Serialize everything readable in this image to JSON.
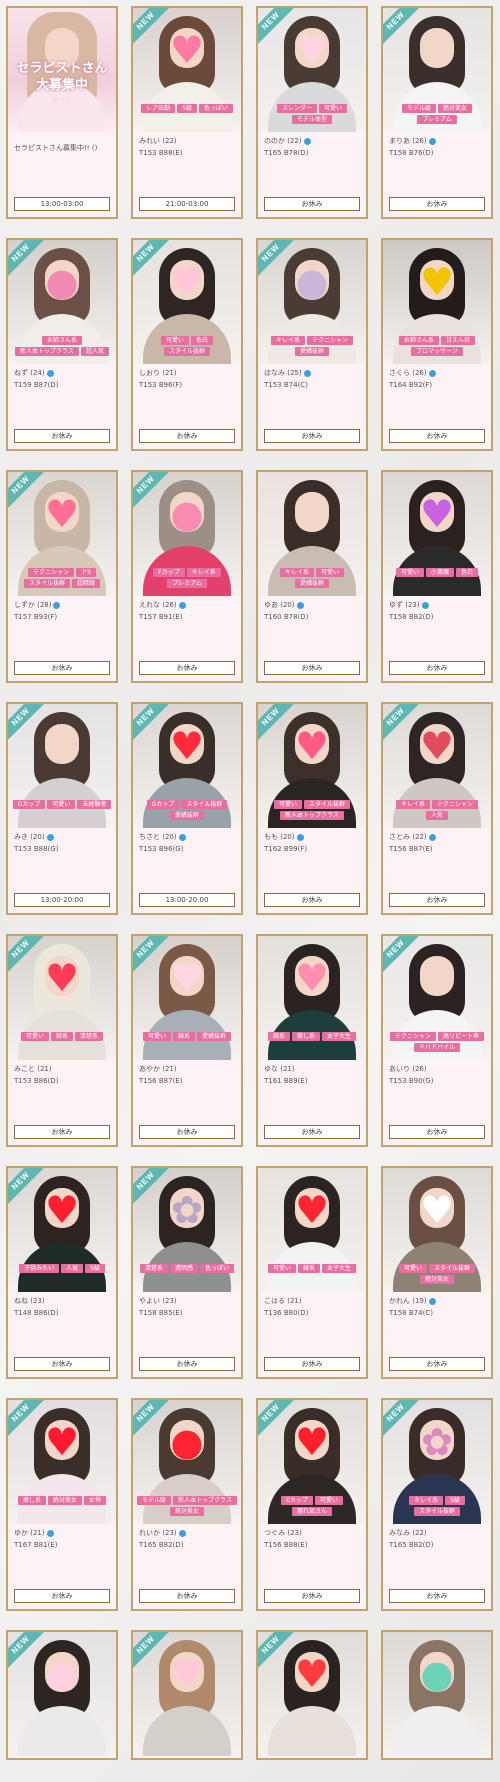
{
  "recruit_card": {
    "title_line1": "セラピストさん",
    "title_line2": "大募集中",
    "subtitle": "セラピ",
    "text": "セラピストさん募集中!! ()",
    "schedule": "13:00-03:00"
  },
  "new_badge_label": "NEW",
  "cards": [
    {
      "name": "みれい (22)",
      "stats": "T153 B88(E)",
      "tags": [
        "レア出勤",
        "S級",
        "色っぽい"
      ],
      "schedule": "21:00-03:00",
      "new": true,
      "verified": false,
      "hair": "#6b4a3a",
      "bg": "#d9d1cf",
      "body": "#f3efe9",
      "stamp": "♥",
      "stamp_color": "#ff7aa2"
    },
    {
      "name": "ののか (22)",
      "stats": "T165 B78(D)",
      "tags": [
        "スレンダー",
        "可愛い",
        "モデル体型"
      ],
      "schedule": "お休み",
      "new": true,
      "verified": true,
      "hair": "#4a3a34",
      "bg": "#e7e5e6",
      "body": "#d9dadb",
      "stamp": "♥",
      "stamp_color": "#ffd3e0"
    },
    {
      "name": "まりあ (26)",
      "stats": "T158 B76(D)",
      "tags": [
        "モデル級",
        "絶対美女",
        "プレミアム"
      ],
      "schedule": "お休み",
      "new": true,
      "verified": true,
      "hair": "#3a2f2c",
      "bg": "#e5e4e2",
      "body": "#f4f4f4",
      "stamp": "",
      "stamp_color": "#fff"
    },
    {
      "name": "ねず (24)",
      "stats": "T159 B87(D)",
      "tags": [
        "お姉さん系",
        "新人本トップクラス",
        "超人気"
      ],
      "schedule": "お休み",
      "new": true,
      "verified": true,
      "hair": "#6a5045",
      "bg": "#d4cfca",
      "body": "#f1ede8",
      "stamp": "●",
      "stamp_color": "#f08ab0"
    },
    {
      "name": "しおり (21)",
      "stats": "T153 B96(F)",
      "tags": [
        "可愛い",
        "色白",
        "スタイル抜群"
      ],
      "schedule": "お休み",
      "new": true,
      "verified": false,
      "hair": "#2e2623",
      "bg": "#e6e1dc",
      "body": "#c9b8a8",
      "stamp": "♥",
      "stamp_color": "#ffc6d8"
    },
    {
      "name": "ほなみ (25)",
      "stats": "T153 B74(C)",
      "tags": [
        "キレイ系",
        "テクニシャン",
        "愛嬌抜群"
      ],
      "schedule": "お休み",
      "new": true,
      "verified": true,
      "hair": "#4b3b35",
      "bg": "#d8d4cf",
      "body": "#efe9e4",
      "stamp": "●",
      "stamp_color": "#c9b6d9"
    },
    {
      "name": "さくら (26)",
      "stats": "T164 B92(F)",
      "tags": [
        "お姉さん系",
        "甘えん坊",
        "プロマッサージ"
      ],
      "schedule": "お休み",
      "new": false,
      "verified": true,
      "hair": "#231c1a",
      "bg": "#cfc8c4",
      "body": "#e8e1dc",
      "stamp": "♥",
      "stamp_color": "#f5c400"
    },
    {
      "name": "しずか (28)",
      "stats": "T157 B93(F)",
      "tags": [
        "テクニシャン",
        "ドS",
        "スタイル抜群",
        "超精鋭"
      ],
      "schedule": "お休み",
      "new": true,
      "verified": true,
      "hair": "#c8b6a6",
      "bg": "#dcd6d2",
      "body": "#d7c8ba",
      "stamp": "♥",
      "stamp_color": "#ff6f95"
    },
    {
      "name": "えれな (26)",
      "stats": "T157 B91(E)",
      "tags": [
        "Fカップ",
        "キレイ系",
        "プレミアム"
      ],
      "schedule": "お休み",
      "new": true,
      "verified": true,
      "hair": "#9e8f86",
      "bg": "#d8d2cc",
      "body": "#e3406b",
      "stamp": "●",
      "stamp_color": "#f78bb1"
    },
    {
      "name": "ゆあ (20)",
      "stats": "T160 B78(D)",
      "tags": [
        "キレイ系",
        "可愛い",
        "愛嬌抜群"
      ],
      "schedule": "お休み",
      "new": false,
      "verified": true,
      "hair": "#3b2e29",
      "bg": "#eae2e0",
      "body": "#c9bcb2",
      "stamp": "",
      "stamp_color": "#fff"
    },
    {
      "name": "ゆず (23)",
      "stats": "T158 B82(D)",
      "tags": [
        "可愛い",
        "小悪魔",
        "色白"
      ],
      "schedule": "お休み",
      "new": false,
      "verified": true,
      "hair": "#2b2220",
      "bg": "#ddd8d6",
      "body": "#2a2a2a",
      "stamp": "♥",
      "stamp_color": "#c862e0"
    },
    {
      "name": "みき (20)",
      "stats": "T153 B88(G)",
      "tags": [
        "Gカップ",
        "可愛い",
        "未経験者"
      ],
      "schedule": "13:00-20:00",
      "new": true,
      "verified": true,
      "hair": "#4a3a33",
      "bg": "#e4e3e4",
      "body": "#d5cfd3",
      "stamp": "",
      "stamp_color": "#fff"
    },
    {
      "name": "ちさと (20)",
      "stats": "T153 B96(G)",
      "tags": [
        "Gカップ",
        "スタイル抜群",
        "愛嬌抜群"
      ],
      "schedule": "13:00-20:00",
      "new": true,
      "verified": true,
      "hair": "#3a2e28",
      "bg": "#dbd6d3",
      "body": "#9aa1a8",
      "stamp": "♥",
      "stamp_color": "#ff2b3a"
    },
    {
      "name": "もも (20)",
      "stats": "T162 B99(F)",
      "tags": [
        "可愛い",
        "スタイル抜群",
        "新人本トップクラス"
      ],
      "schedule": "お休み",
      "new": true,
      "verified": true,
      "hair": "#3d302a",
      "bg": "#d9d3ce",
      "body": "#2a2522",
      "stamp": "♥",
      "stamp_color": "#ff5a86"
    },
    {
      "name": "さとみ (22)",
      "stats": "T156 B87(E)",
      "tags": [
        "キレイ系",
        "テクニシャン",
        "人気"
      ],
      "schedule": "お休み",
      "new": true,
      "verified": true,
      "hair": "#2d2624",
      "bg": "#dedad7",
      "body": "#cfc8c2",
      "stamp": "♥",
      "stamp_color": "#e24a60"
    },
    {
      "name": "みこと (21)",
      "stats": "T153 B86(D)",
      "tags": [
        "可愛い",
        "綺系",
        "清楚系"
      ],
      "schedule": "お休み",
      "new": true,
      "verified": false,
      "hair": "#ece6dc",
      "bg": "#d8d2cc",
      "body": "#e6e0da",
      "stamp": "♥",
      "stamp_color": "#ff3b5a"
    },
    {
      "name": "あやか (21)",
      "stats": "T156 B87(E)",
      "tags": [
        "可愛い",
        "綺系",
        "愛嬌抜群"
      ],
      "schedule": "お休み",
      "new": true,
      "verified": false,
      "hair": "#7a5a46",
      "bg": "#d6d0cb",
      "body": "#a7b0b6",
      "stamp": "♥",
      "stamp_color": "#ffd6e2"
    },
    {
      "name": "ゆな (21)",
      "stats": "T161 B89(E)",
      "tags": [
        "綺系",
        "癒し系",
        "女子大生"
      ],
      "schedule": "お休み",
      "new": false,
      "verified": false,
      "hair": "#2a2321",
      "bg": "#e3e0dc",
      "body": "#1d3e3a",
      "stamp": "♥",
      "stamp_color": "#ff8fb0"
    },
    {
      "name": "あいり (26)",
      "stats": "T153 B90(G)",
      "tags": [
        "テクニシャン",
        "高リピート率",
        "ドバドバイル"
      ],
      "schedule": "お休み",
      "new": true,
      "verified": false,
      "hair": "#2b2322",
      "bg": "#e9e7e6",
      "body": "#f5f5f5",
      "stamp": "",
      "stamp_color": "#fff"
    },
    {
      "name": "ねね (23)",
      "stats": "T148 B86(D)",
      "tags": [
        "子供みたい",
        "人気",
        "S級"
      ],
      "schedule": "お休み",
      "new": true,
      "verified": false,
      "hair": "#2d2320",
      "bg": "#dcd7d3",
      "body": "#1f2b29",
      "stamp": "♥",
      "stamp_color": "#ff1f2f"
    },
    {
      "name": "やよい (23)",
      "stats": "T158 B85(E)",
      "tags": [
        "清楚系",
        "透明感",
        "色っぽい"
      ],
      "schedule": "お休み",
      "new": true,
      "verified": false,
      "hair": "#2b2421",
      "bg": "#d5cfcb",
      "body": "#8f8f8f",
      "stamp": "✿",
      "stamp_color": "#b8a6c8"
    },
    {
      "name": "こはる (21)",
      "stats": "T136 B80(D)",
      "tags": [
        "可愛い",
        "綺系",
        "女子大生"
      ],
      "schedule": "お休み",
      "new": false,
      "verified": false,
      "hair": "#2c2422",
      "bg": "#e7e2df",
      "body": "#f3f3f3",
      "stamp": "♥",
      "stamp_color": "#ff2431"
    },
    {
      "name": "かれん (19)",
      "stats": "T158 B74(C)",
      "tags": [
        "可愛い",
        "スタイル抜群",
        "絶対美女"
      ],
      "schedule": "お休み",
      "new": false,
      "verified": true,
      "hair": "#6a5042",
      "bg": "#dedad6",
      "body": "#8e8176",
      "stamp": "♥",
      "stamp_color": "#ffffff"
    },
    {
      "name": "ゆか (21)",
      "stats": "T167 B81(E)",
      "tags": [
        "癒し系",
        "絶対美女",
        "女神"
      ],
      "schedule": "お休み",
      "new": true,
      "verified": true,
      "hair": "#3a2e29",
      "bg": "#e4dde0",
      "body": "#f3e6ec",
      "stamp": "♥",
      "stamp_color": "#ff1a30"
    },
    {
      "name": "れいか (23)",
      "stats": "T165 B82(D)",
      "tags": [
        "モデル級",
        "新人本トップクラス",
        "絶対美女"
      ],
      "schedule": "お休み",
      "new": true,
      "verified": true,
      "hair": "#4a3a32",
      "bg": "#d8d3cf",
      "body": "#d7cfc7",
      "stamp": "●",
      "stamp_color": "#ff2430"
    },
    {
      "name": "つぐみ (23)",
      "stats": "T156 B88(E)",
      "tags": [
        "Eカップ",
        "可愛い",
        "癒れ気さん"
      ],
      "schedule": "お休み",
      "new": true,
      "verified": false,
      "hair": "#3a2d27",
      "bg": "#e2dedb",
      "body": "#2c2625",
      "stamp": "♥",
      "stamp_color": "#ff1f2a"
    },
    {
      "name": "みなみ (22)",
      "stats": "T165 B82(D)",
      "tags": [
        "キレイ系",
        "S級",
        "スタイル抜群"
      ],
      "schedule": "お休み",
      "new": true,
      "verified": false,
      "hair": "#3a2d29",
      "bg": "#e2e0e0",
      "body": "#2a3552",
      "stamp": "✿",
      "stamp_color": "#d98bc0"
    }
  ],
  "partial_cards": [
    {
      "new": true,
      "hair": "#2d2522",
      "bg": "#e4e2e2",
      "body": "#ece9e9",
      "stamp": "●",
      "stamp_color": "#ffd0e0"
    },
    {
      "new": true,
      "hair": "#b08a6a",
      "bg": "#ddd8d4",
      "body": "#d5cfca",
      "stamp": "♥",
      "stamp_color": "#ffc9d8"
    },
    {
      "new": true,
      "hair": "#2b2321",
      "bg": "#e0dcd8",
      "body": "#e7e0da",
      "stamp": "♥",
      "stamp_color": "#ff3b3b"
    },
    {
      "new": false,
      "hair": "#8a7565",
      "bg": "#dcd9d6",
      "body": "#f0eeee",
      "stamp": "●",
      "stamp_color": "#6cd2b8"
    }
  ]
}
